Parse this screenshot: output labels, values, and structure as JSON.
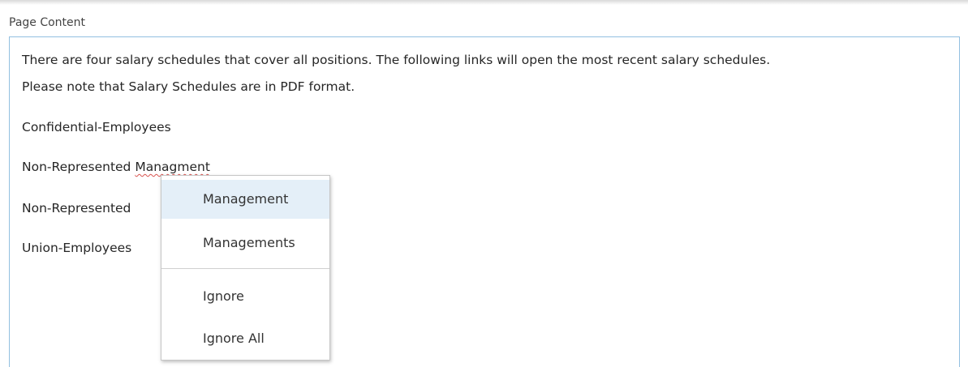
{
  "field": {
    "label": "Page Content"
  },
  "editor": {
    "line1": "There are four salary schedules that cover all positions. The following links will open the most recent salary schedules.",
    "line2": "Please note that Salary Schedules are in PDF format.",
    "link1": "Confidential-Employees",
    "link2_prefix": "Non-Represented ",
    "link2_misspelled": "Managment",
    "link3_prefix": "Non-Represented",
    "link4": "Union-Employees"
  },
  "context_menu": {
    "suggestion1": "Management",
    "suggestion2": "Managements",
    "ignore": "Ignore",
    "ignore_all": "Ignore All"
  },
  "colors": {
    "editor_border": "#92c0e0",
    "highlight": "#e4eff8",
    "spell_underline": "#d9534f"
  }
}
